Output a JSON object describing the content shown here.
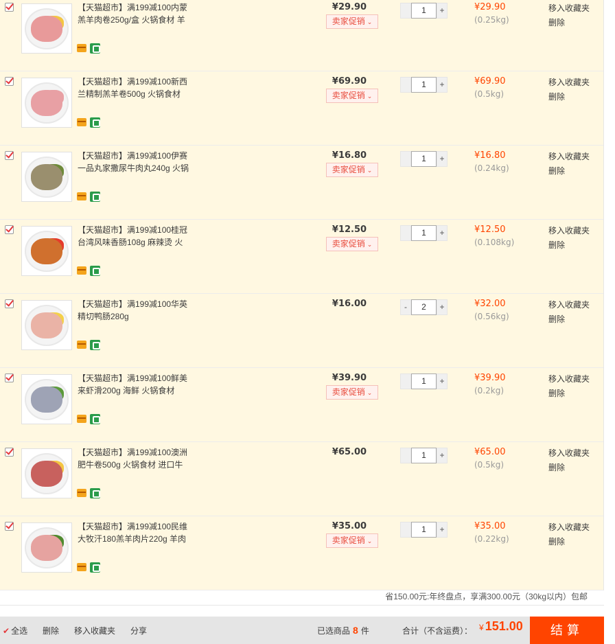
{
  "promo_chevron": "⌄",
  "items": [
    {
      "title": "【天猫超市】满199减100内蒙羔羊肉卷250g/盒 火锅食材 羊",
      "price": "¥29.90",
      "has_promo": true,
      "promo": "卖家促销",
      "qty": "1",
      "minus": "",
      "plus": "+",
      "subtotal": "¥29.90",
      "weight": "(0.25kg)",
      "fav": "移入收藏夹",
      "del": "删除",
      "food_color": "#e89a9a",
      "accent": "#f4c542"
    },
    {
      "title": "【天猫超市】满199减100新西兰精制羔羊卷500g 火锅食材",
      "price": "¥69.90",
      "has_promo": true,
      "promo": "卖家促销",
      "qty": "1",
      "minus": "",
      "plus": "+",
      "subtotal": "¥69.90",
      "weight": "(0.5kg)",
      "fav": "移入收藏夹",
      "del": "删除",
      "food_color": "#e8a0a4",
      "accent": "#e8a0a4"
    },
    {
      "title": "【天猫超市】满199减100伊赛一品丸家撒尿牛肉丸240g 火锅",
      "price": "¥16.80",
      "has_promo": true,
      "promo": "卖家促销",
      "qty": "1",
      "minus": "",
      "plus": "+",
      "subtotal": "¥16.80",
      "weight": "(0.24kg)",
      "fav": "移入收藏夹",
      "del": "删除",
      "food_color": "#9a8f6e",
      "accent": "#6e8a3a"
    },
    {
      "title": "【天猫超市】满199减100桂冠台湾风味香肠108g 麻辣烫 火",
      "price": "¥12.50",
      "has_promo": true,
      "promo": "卖家促销",
      "qty": "1",
      "minus": "",
      "plus": "+",
      "subtotal": "¥12.50",
      "weight": "(0.108kg)",
      "fav": "移入收藏夹",
      "del": "删除",
      "food_color": "#d0702e",
      "accent": "#e53b2c"
    },
    {
      "title": "【天猫超市】满199减100华英精切鸭肠280g",
      "price": "¥16.00",
      "has_promo": false,
      "promo": "",
      "qty": "2",
      "minus": "-",
      "plus": "+",
      "subtotal": "¥32.00",
      "weight": "(0.56kg)",
      "fav": "移入收藏夹",
      "del": "删除",
      "food_color": "#eab3a6",
      "accent": "#f4d04a"
    },
    {
      "title": "【天猫超市】满199减100鲜美来虾滑200g 海鲜 火锅食材",
      "price": "¥39.90",
      "has_promo": true,
      "promo": "卖家促销",
      "qty": "1",
      "minus": "",
      "plus": "+",
      "subtotal": "¥39.90",
      "weight": "(0.2kg)",
      "fav": "移入收藏夹",
      "del": "删除",
      "food_color": "#9ea3b5",
      "accent": "#5c9a3a"
    },
    {
      "title": "【天猫超市】满199减100澳洲肥牛卷500g 火锅食材 进口牛",
      "price": "¥65.00",
      "has_promo": false,
      "promo": "",
      "qty": "1",
      "minus": "",
      "plus": "+",
      "subtotal": "¥65.00",
      "weight": "(0.5kg)",
      "fav": "移入收藏夹",
      "del": "删除",
      "food_color": "#c8615e",
      "accent": "#f4c542"
    },
    {
      "title": "【天猫超市】满199减100民维大牧汗180羔羊肉片220g 羊肉",
      "price": "¥35.00",
      "has_promo": true,
      "promo": "卖家促销",
      "qty": "1",
      "minus": "",
      "plus": "+",
      "subtotal": "¥35.00",
      "weight": "(0.22kg)",
      "fav": "移入收藏夹",
      "del": "删除",
      "food_color": "#e6a3a0",
      "accent": "#4f8a2e"
    }
  ],
  "shipping_note": "省150.00元:年终盘点，享满300.00元（30kg以内）包邮",
  "bottom_bar": {
    "select_all": "全选",
    "delete": "删除",
    "move_fav": "移入收藏夹",
    "share": "分享",
    "selected_label": "已选商品",
    "selected_count": "8",
    "selected_unit": "件",
    "total_label": "合计（不含运费）：",
    "currency": "¥",
    "total_amount": "151.00",
    "checkout": "结算"
  }
}
